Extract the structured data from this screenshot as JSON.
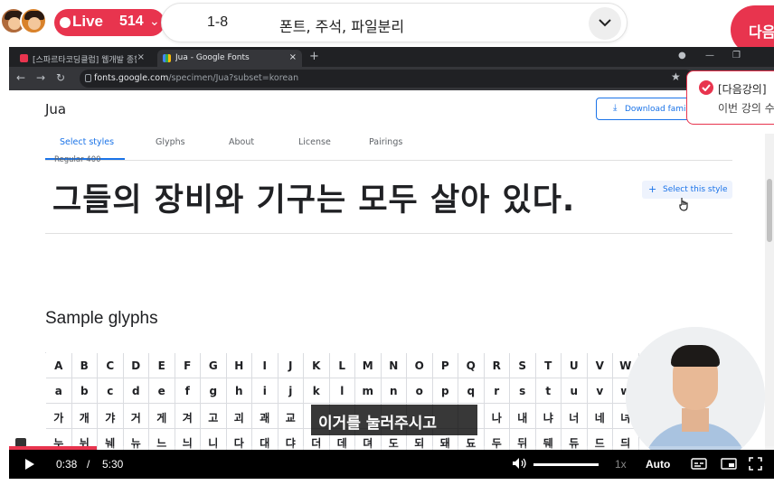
{
  "header": {
    "live_label": "Live",
    "viewer_count": "514",
    "lecture_number": "1-8",
    "lecture_title": "폰트, 주석, 파일분리",
    "next_button_label": "다음"
  },
  "browser": {
    "tabs": [
      {
        "title": "[스파르타코딩클럽] 웹개발 종합"
      },
      {
        "title": "Jua - Google Fonts"
      }
    ],
    "url_host": "fonts.google.com",
    "url_path": "/specimen/Jua?subset=korean"
  },
  "page": {
    "font_name": "Jua",
    "download_label": "Download family",
    "tabs": [
      "Select styles",
      "Glyphs",
      "About",
      "License",
      "Pairings"
    ],
    "style_name": "Regular 400",
    "sample_text": "그들의 장비와 기구는 모두 살아 있다.",
    "select_style_label": "Select this style",
    "glyph_heading": "Sample glyphs",
    "glyph_rows": [
      [
        "A",
        "B",
        "C",
        "D",
        "E",
        "F",
        "G",
        "H",
        "I",
        "J",
        "K",
        "L",
        "M",
        "N",
        "O",
        "P",
        "Q",
        "R",
        "S",
        "T",
        "U",
        "V",
        "W"
      ],
      [
        "a",
        "b",
        "c",
        "d",
        "e",
        "f",
        "g",
        "h",
        "i",
        "j",
        "k",
        "l",
        "m",
        "n",
        "o",
        "p",
        "q",
        "r",
        "s",
        "t",
        "u",
        "v",
        "w"
      ],
      [
        "가",
        "개",
        "갸",
        "거",
        "게",
        "겨",
        "고",
        "괴",
        "괘",
        "교",
        "",
        "",
        "",
        "",
        "",
        "",
        "",
        "나",
        "내",
        "냐",
        "너",
        "네",
        "녀"
      ],
      [
        "누",
        "뉘",
        "눼",
        "뉴",
        "느",
        "늬",
        "니",
        "다",
        "대",
        "댜",
        "더",
        "데",
        "뎌",
        "도",
        "되",
        "돼",
        "됴",
        "두",
        "뒤",
        "뒈",
        "듀",
        "드",
        "듸"
      ]
    ]
  },
  "toast": {
    "title": "[다음강의]",
    "body": "이번 강의 수"
  },
  "subtitle": "이거를 눌러주시고",
  "player": {
    "current_time": "0:38",
    "separator": "/",
    "duration": "5:30",
    "speed": "1x",
    "quality": "Auto",
    "progress_fraction": 0.115,
    "volume_fraction": 1.0
  },
  "colors": {
    "brand": "#e8344e",
    "google_blue": "#1a73e8"
  },
  "icons": {
    "play": "play-icon",
    "volume": "volume-icon",
    "subtitles": "subtitles-icon",
    "pip": "pip-icon",
    "fullscreen": "fullscreen-icon"
  }
}
